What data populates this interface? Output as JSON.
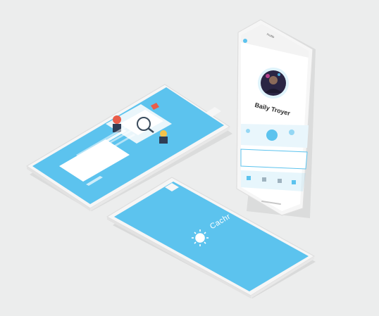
{
  "onboarding": {
    "heading": "",
    "body": "",
    "primary_button": "",
    "secondary_link": ""
  },
  "splash": {
    "brand": "Cachr",
    "logo_icon": "sun-icon"
  },
  "profile": {
    "nav_title": "Profile",
    "name": "Baily Troyer",
    "handle": "",
    "message_placeholder": "",
    "tabs": [
      "",
      "",
      "",
      ""
    ]
  },
  "colors": {
    "accent": "#5cc3ee",
    "background": "#eceded",
    "device": "#f7f7f7"
  }
}
